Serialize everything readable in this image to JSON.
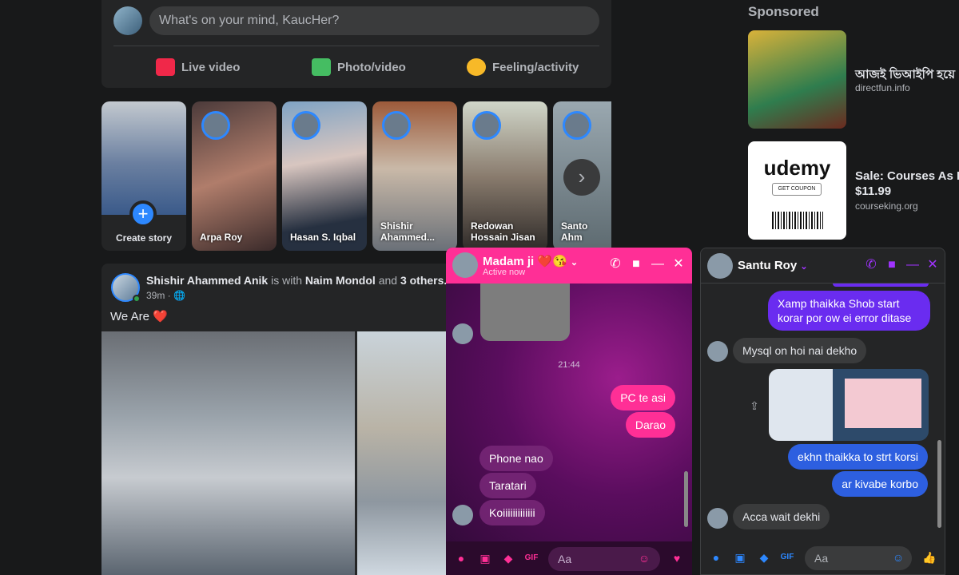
{
  "composer": {
    "placeholder": "What's on your mind, KaucHer?",
    "actions": [
      "Live video",
      "Photo/video",
      "Feeling/activity"
    ]
  },
  "stories": {
    "create_label": "Create story",
    "plus": "+",
    "next": "›",
    "items": [
      {
        "name": "Arpa Roy"
      },
      {
        "name": "Hasan S. Iqbal"
      },
      {
        "name": "Shishir Ahammed..."
      },
      {
        "name": "Redowan Hossain Jisan"
      },
      {
        "name": "Santo Ahm"
      }
    ]
  },
  "post": {
    "author": "Shishir Ahammed Anik",
    "with_text": "is with",
    "tagged": "Naim Mondol",
    "and_text": "and",
    "others": "3 others.",
    "time": "39m · 🌐",
    "text": "We Are ❤️"
  },
  "sponsored": {
    "title": "Sponsored",
    "ads": [
      {
        "title": "আজই ভিআইপি হয়ে",
        "source": "directfun.info"
      },
      {
        "title": "Sale: Courses As Low",
        "price": "$11.99",
        "source": "courseking.org",
        "brand": "udemy",
        "coupon": "GET COUPON"
      }
    ]
  },
  "chat1": {
    "name": "Madam ji ❤️😘",
    "status": "Active now",
    "time_divider": "21:44",
    "messages": [
      {
        "from": "me",
        "text": "PC te asi"
      },
      {
        "from": "me",
        "text": "Darao"
      },
      {
        "from": "them",
        "text": "Phone nao"
      },
      {
        "from": "them",
        "text": "Taratari"
      },
      {
        "from": "them",
        "text": "Koiiiiiiiiiiiii"
      }
    ],
    "input_placeholder": "Aa"
  },
  "chat2": {
    "name": "Santu Roy",
    "messages": [
      {
        "from": "me",
        "text": "Xamp thaikka Shob start korar por ow ei error ditase"
      },
      {
        "from": "them",
        "text": "Mysql on hoi nai dekho"
      },
      {
        "from": "me",
        "text": "ekhn thaikka to strt korsi"
      },
      {
        "from": "me",
        "text": "ar kivabe korbo"
      },
      {
        "from": "them",
        "text": "Acca wait dekhi"
      }
    ],
    "input_placeholder": "Aa"
  },
  "colors": {
    "bg": "#18191a",
    "card": "#242526",
    "accent": "#2d88ff",
    "chat1_header": "#ff2f96",
    "chat2_accent": "#a033ff"
  }
}
